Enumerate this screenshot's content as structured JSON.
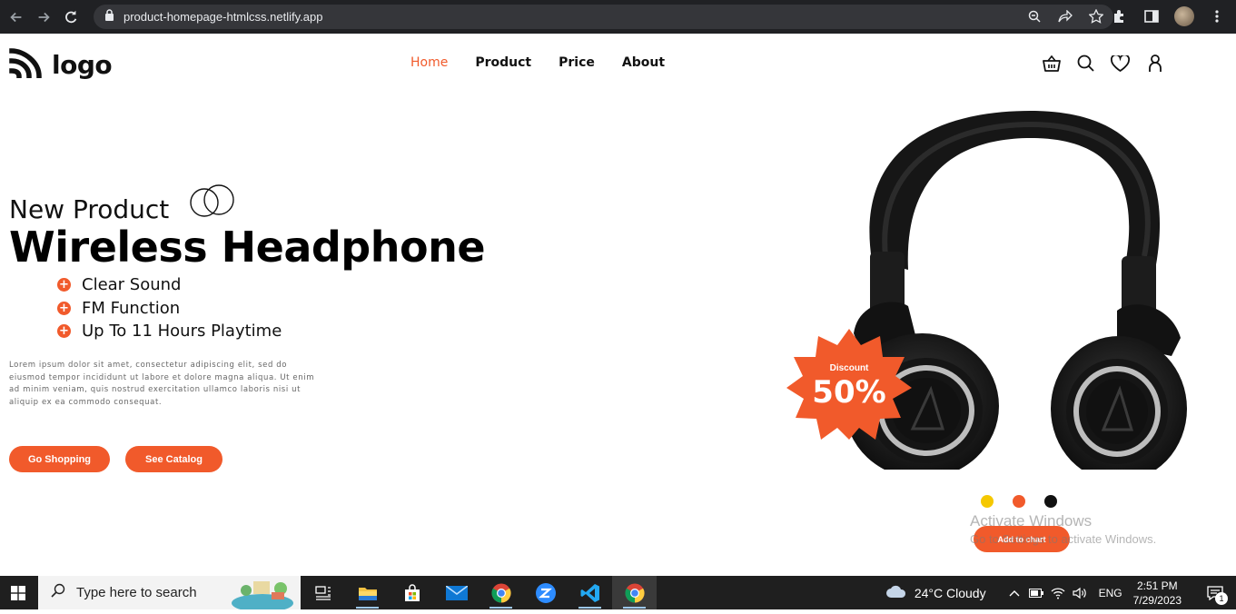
{
  "browser": {
    "url": "product-homepage-htmlcss.netlify.app"
  },
  "site": {
    "logo_text": "logo",
    "menu": [
      {
        "label": "Home",
        "active": true
      },
      {
        "label": "Product",
        "active": false
      },
      {
        "label": "Price",
        "active": false
      },
      {
        "label": "About",
        "active": false
      }
    ],
    "icons": [
      "basket-icon",
      "search-icon",
      "heart-icon",
      "user-icon"
    ]
  },
  "hero": {
    "subtitle": "New Product",
    "title": "Wireless Headphone",
    "features": [
      "Clear Sound",
      "FM Function",
      "Up To 11 Hours Playtime"
    ],
    "description": "Lorem ipsum dolor sit amet, consectetur adipiscing elit, sed do eiusmod tempor incididunt ut labore et dolore magna aliqua. Ut enim ad minim veniam, quis nostrud exercitation ullamco laboris nisi ut aliquip ex ea commodo consequat.",
    "buttons": {
      "shop": "Go Shopping",
      "catalog": "See Catalog"
    }
  },
  "product": {
    "badge_label": "Discount",
    "badge_value": "50%",
    "colors": [
      "#f5c800",
      "#f15a2b",
      "#111111"
    ],
    "cart_label": "Add to chart"
  },
  "watermark": {
    "line1": "Activate Windows",
    "line2": "Go to Settings to activate Windows."
  },
  "taskbar": {
    "search_placeholder": "Type here to search",
    "weather": "24°C  Cloudy",
    "lang": "ENG",
    "time": "2:51 PM",
    "date": "7/29/2023",
    "notifications": "1"
  },
  "theme": {
    "accent": "#f15a2b"
  }
}
